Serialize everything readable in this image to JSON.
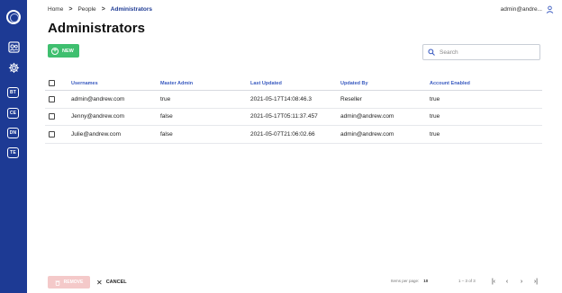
{
  "sidebar": {
    "badges": [
      "BT",
      "CE",
      "DN",
      "TE"
    ],
    "icons": [
      "logo-icon",
      "people-icon",
      "settings-icon"
    ]
  },
  "breadcrumb": {
    "items": [
      "Home",
      "People",
      "Administrators"
    ],
    "separator": ">"
  },
  "header": {
    "user": "admin@andre..."
  },
  "page": {
    "title": "Administrators"
  },
  "toolbar": {
    "new_label": "NEW",
    "search_placeholder": "Search"
  },
  "table": {
    "columns": [
      "Usernames",
      "Master Admin",
      "Last Updated",
      "Updated By",
      "Account Enabled"
    ],
    "rows": [
      {
        "username": "admin@andrew.com",
        "master_admin": "true",
        "last_updated": "2021-05-17T14:08:46.3",
        "updated_by": "Reseller",
        "account_enabled": "true"
      },
      {
        "username": "Jenny@andrew.com",
        "master_admin": "false",
        "last_updated": "2021-05-17T05:11:37.457",
        "updated_by": "admin@andrew.com",
        "account_enabled": "true"
      },
      {
        "username": "Julie@andrew.com",
        "master_admin": "false",
        "last_updated": "2021-05-07T21:06:02.66",
        "updated_by": "admin@andrew.com",
        "account_enabled": "true"
      }
    ]
  },
  "footer": {
    "remove_label": "REMOVE",
    "cancel_label": "CANCEL",
    "items_per_page_label": "Items per page:",
    "items_per_page_value": "10",
    "range": "1 – 3 of 3"
  },
  "colors": {
    "sidebar": "#1d3a94",
    "accent": "#3a5bc0",
    "new_button": "#3fbf6f",
    "remove_button_disabled": "#f4c9c9"
  }
}
